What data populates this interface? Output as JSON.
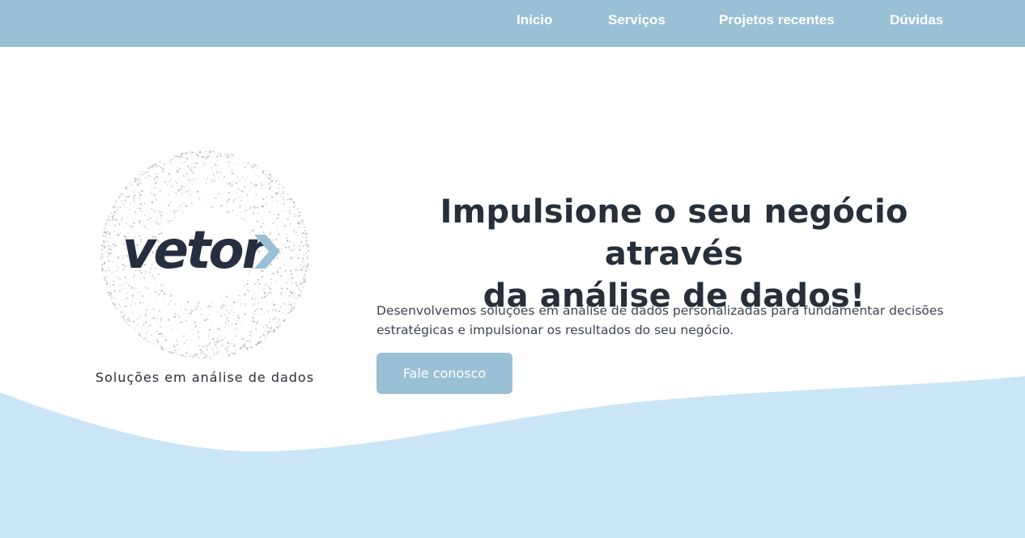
{
  "nav": {
    "items": [
      {
        "label": "Início"
      },
      {
        "label": "Serviços"
      },
      {
        "label": "Projetos recentes"
      },
      {
        "label": "Dúvidas"
      }
    ]
  },
  "logo": {
    "wordmark": "vetor",
    "tagline": "Soluções em análise de dados"
  },
  "hero": {
    "title_line1": "Impulsione o seu negócio através",
    "title_line2": "da análise de dados!",
    "description": "Desenvolvemos soluções em análise de dados personalizadas para fundamentar decisões estratégicas e impulsionar os resultados do seu negócio.",
    "cta_label": "Fale conosco"
  },
  "colors": {
    "nav_bg": "#9ac0d6",
    "wave": "#cae5f6",
    "text_dark": "#262f3a",
    "logo_dark": "#262f40",
    "logo_accent": "#9ac0d6"
  }
}
